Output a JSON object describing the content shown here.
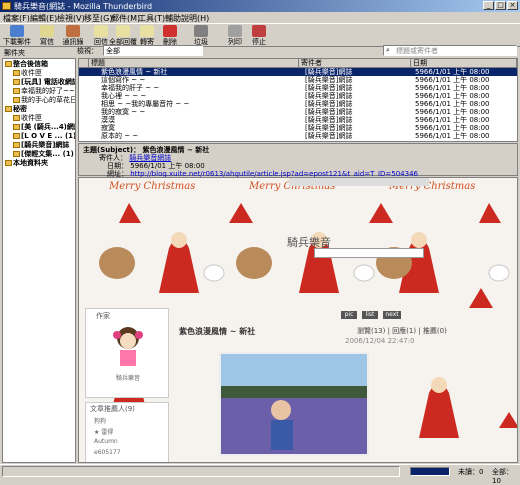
{
  "window": {
    "title": "騎兵樂音(網誌 - Mozilla Thunderbird"
  },
  "menu": [
    "檔案(F)",
    "編輯(E)",
    "檢視(V)",
    "移至(G)",
    "郵件(M)",
    "工具(T)",
    "輔助說明(H)"
  ],
  "toolbar": [
    {
      "label": "下載郵件"
    },
    {
      "label": "寫信"
    },
    {
      "label": "通訊錄"
    },
    {
      "label": "回信"
    },
    {
      "label": "全部回覆"
    },
    {
      "label": "轉寄"
    },
    {
      "label": "刪除"
    },
    {
      "label": "垃圾"
    },
    {
      "label": "列印"
    },
    {
      "label": "停止"
    }
  ],
  "folders_header": "郵件夾",
  "view_label": "檢視：",
  "view_value": "全部",
  "search_placeholder": "標題或寄件者",
  "folders": [
    {
      "label": "整合後信箱",
      "bold": true
    },
    {
      "label": "收件匣"
    },
    {
      "label": "[玩具] 電話收網誌",
      "bold": true
    },
    {
      "label": "幸福我的好了~~~"
    },
    {
      "label": "我的手心的草花日誌"
    },
    {
      "label": "秘密",
      "bold": true
    },
    {
      "label": "收件匣"
    },
    {
      "label": "[美 (騎兵...4)網誌",
      "bold": true
    },
    {
      "label": "[L O V E ... (1)",
      "bold": true
    },
    {
      "label": "[騎兵樂音]網誌",
      "bold": true
    },
    {
      "label": "[傑輕文集... (1)",
      "bold": true
    },
    {
      "label": "本地資料夾",
      "bold": true
    }
  ],
  "columns": {
    "subject": "標題",
    "sender": "寄件者",
    "date": "日期"
  },
  "messages": [
    {
      "subject": "紫色浪漫風情 ~ 新社",
      "sender": "[騎兵樂音]網誌",
      "date": "5966/1/01 上午 08:00",
      "selected": true
    },
    {
      "subject": "這個寫作 ~ ~",
      "sender": "[騎兵樂音]網誌",
      "date": "5966/1/01 上午 08:00"
    },
    {
      "subject": "幸福我的肝子 ~ ~",
      "sender": "[騎兵樂音]網誌",
      "date": "5966/1/01 上午 08:00"
    },
    {
      "subject": "我心裡 ~ ~ ~",
      "sender": "[騎兵樂音]網誌",
      "date": "5966/1/01 上午 08:00"
    },
    {
      "subject": "相思 ~ ~我的專屬音符 ~ ~",
      "sender": "[騎兵樂音]網誌",
      "date": "5966/1/01 上午 08:00"
    },
    {
      "subject": "我的寂寞 ~ ~",
      "sender": "[騎兵樂音]網誌",
      "date": "5966/1/01 上午 08:00"
    },
    {
      "subject": "漠漠",
      "sender": "[騎兵樂音]網誌",
      "date": "5966/1/01 上午 08:00"
    },
    {
      "subject": "寂寞",
      "sender": "[騎兵樂音]網誌",
      "date": "5966/1/01 上午 08:00"
    },
    {
      "subject": "原本的 ~ ~",
      "sender": "[騎兵樂音]網誌",
      "date": "5966/1/01 上午 08:00"
    }
  ],
  "header_pane": {
    "subject_label": "主題(Subject)",
    "subject": "紫色浪漫風情 ~ 新社",
    "from_label": "寄件人：",
    "from": "騎兵樂音網誌",
    "date_label": "日期：",
    "date": "5966/1/01 上午 08:00",
    "link_label": "網址：",
    "link": "http://blog.xuite.net/r0613/ahgutile/article.jsp?ad=epost121&t_aid=T_ID=504346"
  },
  "blog": {
    "banner_title": "騎兵樂音",
    "xmas": "Merry Christmas",
    "author_box_title": "作家",
    "author_name": "騎兵樂音",
    "post_title": "紫色浪漫風情 ~ 新社",
    "post_stats": "瀏覽(13) | 回應(1) | 推薦(0)",
    "post_date": "2006/12/04 22:47:0",
    "recommend_title": "文章推薦人(9)",
    "recommenders": [
      "狗狗",
      "★ 雷得",
      "Autumn",
      "e605177"
    ],
    "nav_buttons": [
      "pic",
      "list",
      "next"
    ]
  },
  "status": {
    "unread_label": "未讀：",
    "unread": "0",
    "total_label": "全部：",
    "total": "10"
  }
}
